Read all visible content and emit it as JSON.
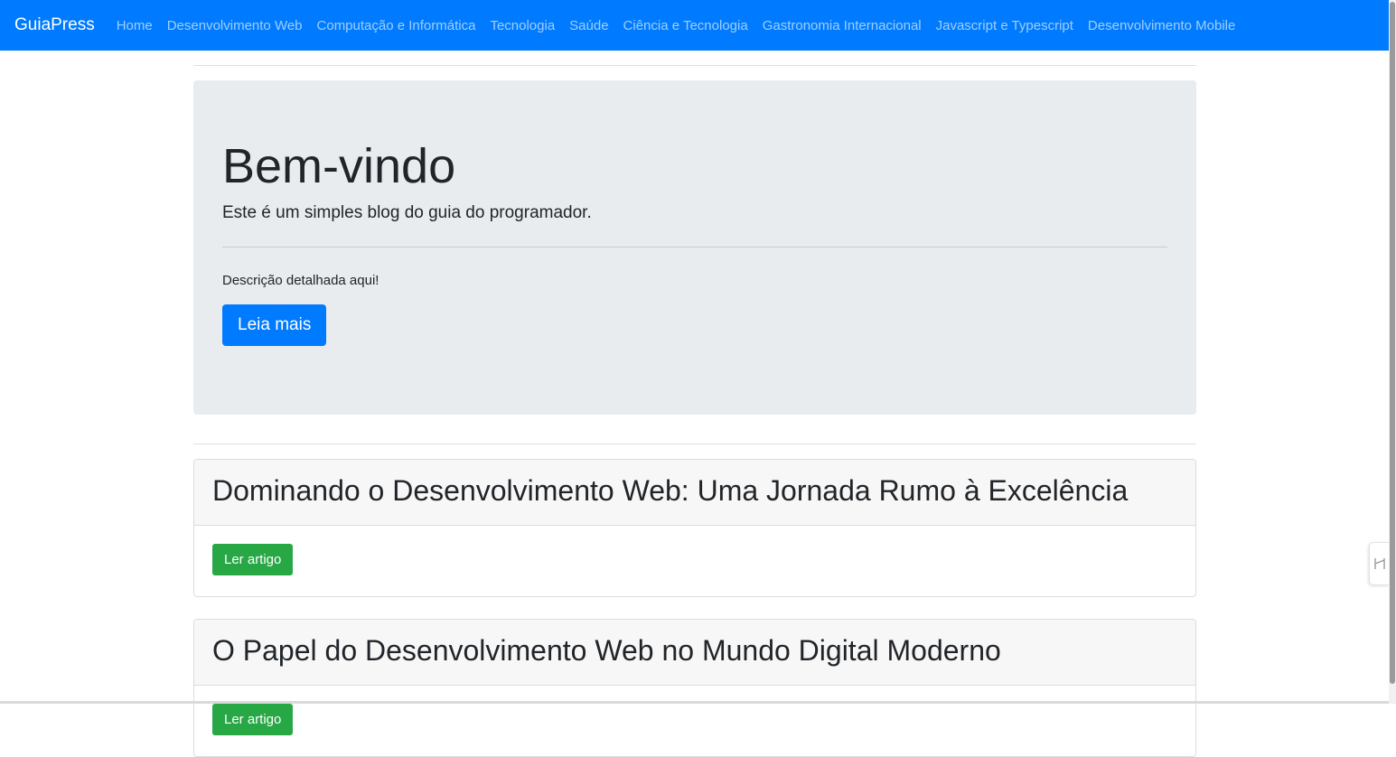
{
  "navbar": {
    "brand": "GuiaPress",
    "links": [
      "Home",
      "Desenvolvimento Web",
      "Computação e Informática",
      "Tecnologia",
      "Saúde",
      "Ciência e Tecnologia",
      "Gastronomia Internacional",
      "Javascript e Typescript",
      "Desenvolvimento Mobile"
    ]
  },
  "jumbotron": {
    "title": "Bem-vindo",
    "lead": "Este é um simples blog do guia do programador.",
    "description": "Descrição detalhada aqui!",
    "button": "Leia mais"
  },
  "articles": [
    {
      "title": "Dominando o Desenvolvimento Web: Uma Jornada Rumo à Excelência",
      "button": "Ler artigo"
    },
    {
      "title": "O Papel do Desenvolvimento Web no Mundo Digital Moderno",
      "button": "Ler artigo"
    }
  ],
  "colors": {
    "navbar": "#007bff",
    "primary_button": "#007bff",
    "success_button": "#28a745",
    "jumbotron_bg": "#e9ecef"
  },
  "side_tab": {
    "icon": "side-panel-toggle-icon"
  }
}
